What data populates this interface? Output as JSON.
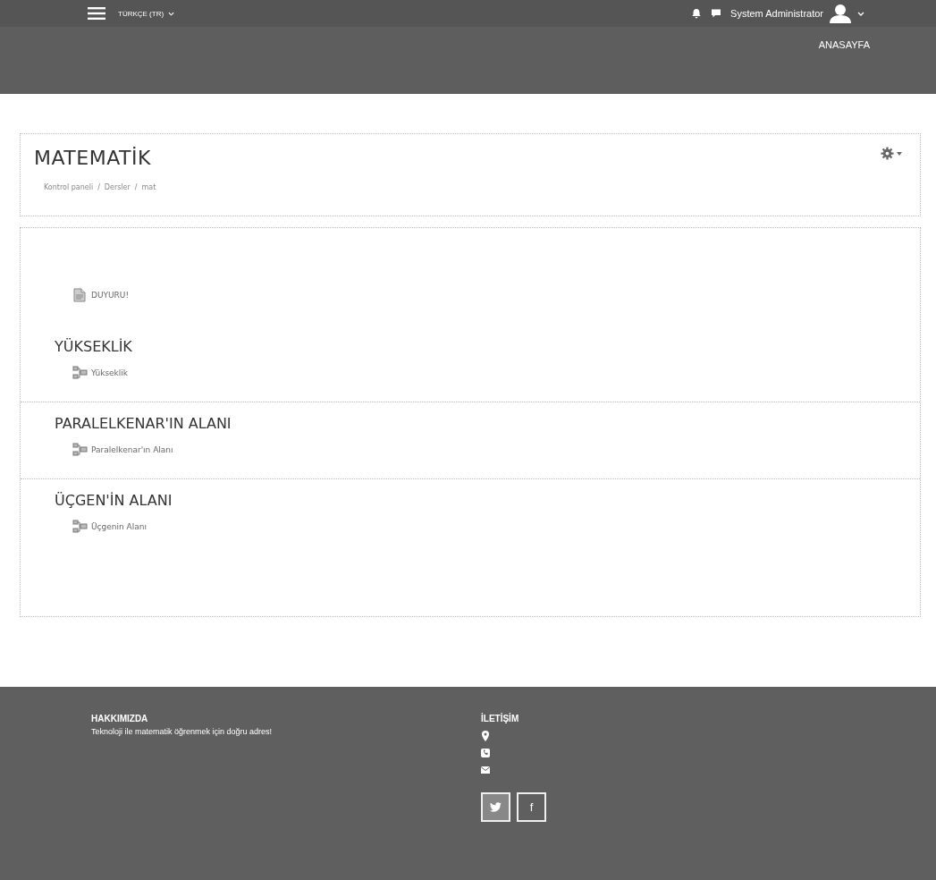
{
  "navbar": {
    "language": "TÜRKÇE (TR)",
    "user_name": "System Administrator"
  },
  "header_nav": [
    "ANASAYFA"
  ],
  "page_header": {
    "title": "MATEMATİK",
    "breadcrumb": [
      "Kontrol paneli",
      "Dersler",
      "mat"
    ],
    "breadcrumb_separator": "/"
  },
  "sections": [
    {
      "activities": [
        {
          "kind": "page",
          "label": "DUYURU!"
        }
      ]
    },
    {
      "title": "YÜKSEKLİK",
      "activities": [
        {
          "kind": "module",
          "label": "Yükseklik"
        }
      ]
    },
    {
      "title": "PARALELKENAR'IN ALANI",
      "activities": [
        {
          "kind": "module",
          "label": "Paralelkenar'ın Alanı"
        }
      ]
    },
    {
      "title": "ÜÇGEN'İN ALANI",
      "activities": [
        {
          "kind": "module",
          "label": "Üçgenin Alanı"
        }
      ]
    }
  ],
  "footer": {
    "about_title": "HAKKIMIZDA",
    "about_text": "Teknoloji ile matematik öğrenmek için doğru adres!",
    "contact_title": "İLETİŞİM",
    "contacts": [
      {
        "kind": "location"
      },
      {
        "kind": "phone"
      },
      {
        "kind": "mail"
      }
    ],
    "social": [
      {
        "kind": "twitter"
      },
      {
        "kind": "facebook",
        "glyph": "f"
      }
    ]
  }
}
